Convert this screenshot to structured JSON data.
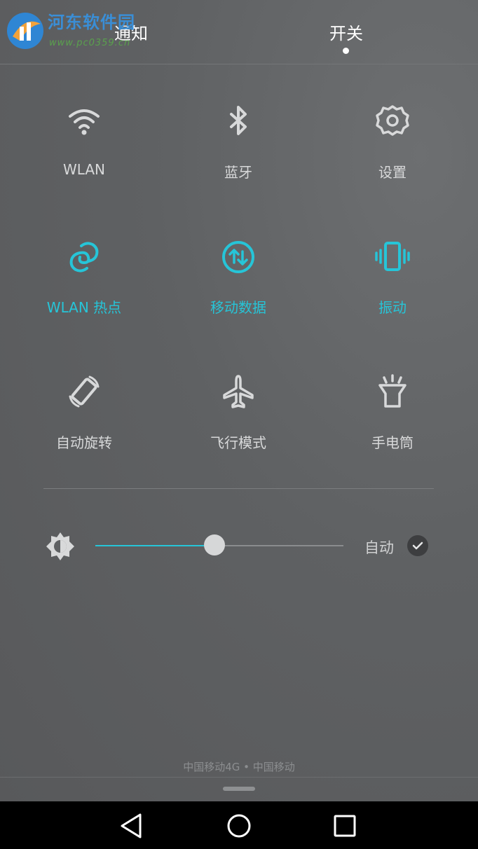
{
  "watermark": {
    "title": "河东软件园",
    "url": "www.pc0359.cn"
  },
  "tabs": [
    {
      "label": "通知",
      "active": false
    },
    {
      "label": "开关",
      "active": true
    }
  ],
  "tiles": [
    {
      "label": "WLAN",
      "icon": "wifi-icon",
      "active": false
    },
    {
      "label": "蓝牙",
      "icon": "bluetooth-icon",
      "active": false
    },
    {
      "label": "设置",
      "icon": "gear-icon",
      "active": false
    },
    {
      "label": "WLAN 热点",
      "icon": "hotspot-icon",
      "active": true
    },
    {
      "label": "移动数据",
      "icon": "mobile-data-icon",
      "active": true
    },
    {
      "label": "振动",
      "icon": "vibrate-icon",
      "active": true
    },
    {
      "label": "自动旋转",
      "icon": "auto-rotate-icon",
      "active": false
    },
    {
      "label": "飞行模式",
      "icon": "airplane-icon",
      "active": false
    },
    {
      "label": "手电筒",
      "icon": "flashlight-icon",
      "active": false
    }
  ],
  "brightness": {
    "level_percent": 48,
    "auto_label": "自动",
    "auto_checked": true
  },
  "carrier_text": "中国移动4G • 中国移动",
  "colors": {
    "accent": "#26c5d8",
    "inactive": "#d8d9da",
    "background": "#5f6163"
  }
}
